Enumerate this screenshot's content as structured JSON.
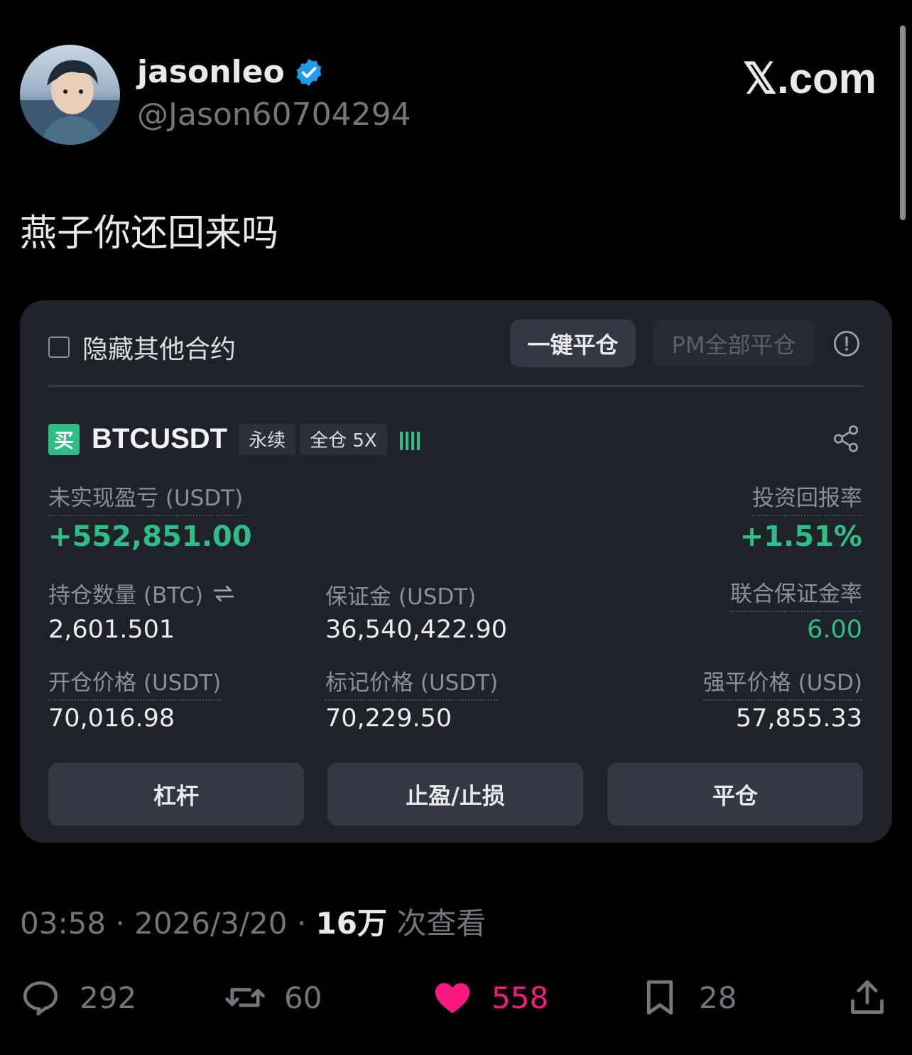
{
  "author": {
    "name": "jasonleo",
    "handle": "@Jason60704294",
    "verified": true
  },
  "brand": "𝕏.com",
  "tweet": {
    "text": "燕子你还回来吗"
  },
  "card": {
    "hide_label": "隐藏其他合约",
    "close_all_label": "一键平仓",
    "pm_close_all_label": "PM全部平仓",
    "side_tag": "买",
    "symbol": "BTCUSDT",
    "tags": [
      "永续",
      "全仓 5X"
    ],
    "unrealized_pnl_label": "未实现盈亏 (USDT)",
    "unrealized_pnl_value": "+552,851.00",
    "roi_label": "投资回报率",
    "roi_value": "+1.51%",
    "position_size_label": "持仓数量 (BTC)",
    "position_size_value": "2,601.501",
    "margin_label": "保证金 (USDT)",
    "margin_value": "36,540,422.90",
    "margin_ratio_label": "联合保证金率",
    "margin_ratio_value": "6.00",
    "entry_price_label": "开仓价格 (USDT)",
    "entry_price_value": "70,016.98",
    "mark_price_label": "标记价格 (USDT)",
    "mark_price_value": "70,229.50",
    "liq_price_label": "强平价格 (USD)",
    "liq_price_value": "57,855.33",
    "leverage_button": "杠杆",
    "tpsl_button": "止盈/止损",
    "close_button": "平仓",
    "colors": {
      "profit": "#2ebd85",
      "card_bg": "#1f2228"
    }
  },
  "meta": {
    "time": "03:58",
    "date": "2026/3/20",
    "views_count": "16万",
    "views_label": "次查看"
  },
  "actions": {
    "replies": "292",
    "reposts": "60",
    "likes": "558",
    "bookmarks": "28",
    "like_color": "#f91880"
  }
}
